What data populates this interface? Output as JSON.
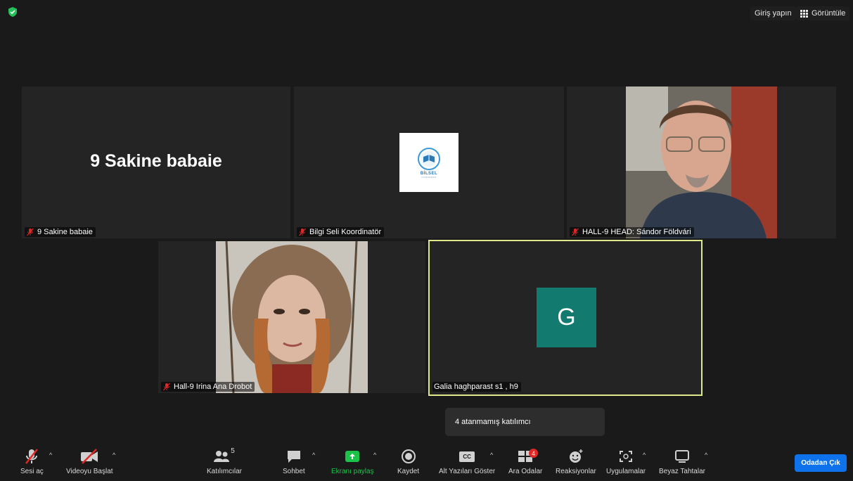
{
  "topbar": {
    "signin": "Giriş yapın",
    "view": "Görüntüle"
  },
  "tiles": [
    {
      "big_name": "9 Sakine babaie",
      "label": "9 Sakine babaie"
    },
    {
      "logo_text": "BİLSEL",
      "logo_sub": "CONGRESS",
      "label": "Bilgi Seli Koordinatör"
    },
    {
      "label": "HALL-9 HEAD: Sándor Földvári"
    },
    {
      "label": "Hall-9 Irina Ana Drobot"
    },
    {
      "avatar_letter": "G",
      "label": "Galia haghparast s1 , h9"
    }
  ],
  "tooltip": "4 atanmamış katılımcı",
  "toolbar": {
    "unmute": "Sesi aç",
    "start_video": "Videoyu Başlat",
    "participants": "Katılımcılar",
    "participant_count": "5",
    "chat": "Sohbet",
    "share_screen": "Ekranı paylaş",
    "record": "Kaydet",
    "captions": "Alt Yazıları Göster",
    "captions_badge": "CC",
    "breakout_rooms": "Ara Odalar",
    "breakout_badge": "4",
    "reactions": "Reaksiyonlar",
    "apps": "Uygulamalar",
    "whiteboard": "Beyaz Tahtalar",
    "leave": "Odadan Çık"
  },
  "colors": {
    "accent_green": "#1cc34b",
    "leave_blue": "#0e72ed",
    "mute_red": "#e02828",
    "active_border": "#dfe88a"
  }
}
